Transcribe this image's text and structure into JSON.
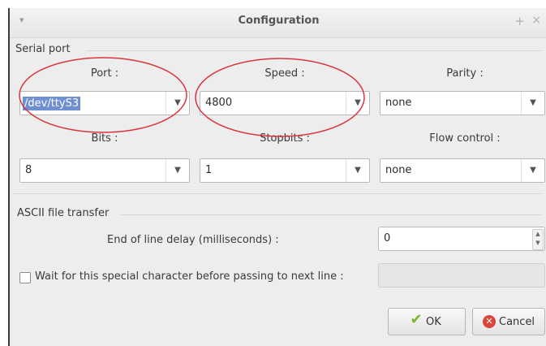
{
  "window": {
    "title": "Configuration",
    "menu_glyph": "▾",
    "max_glyph": "+",
    "close_glyph": "×"
  },
  "serial_port": {
    "section_title": "Serial port",
    "port": {
      "label": "Port :",
      "value": "/dev/ttyS3",
      "selected": true
    },
    "speed": {
      "label": "Speed :",
      "value": "4800"
    },
    "parity": {
      "label": "Parity :",
      "value": "none"
    },
    "bits": {
      "label": "Bits :",
      "value": "8"
    },
    "stopbits": {
      "label": "Stopbits :",
      "value": "1"
    },
    "flow_control": {
      "label": "Flow control :",
      "value": "none"
    },
    "dropdown_arrow": "▼"
  },
  "ascii_transfer": {
    "section_title": "ASCII file transfer",
    "eol_delay_label": "End of line delay (milliseconds) :",
    "eol_delay_value": "0",
    "wait_char_label": "Wait for this special character before passing to next line :",
    "wait_char_checked": false,
    "wait_char_value": ""
  },
  "buttons": {
    "ok_label": "OK",
    "cancel_label": "Cancel",
    "ok_icon": "check-icon",
    "cancel_icon": "cancel-icon"
  },
  "annotation_color": "#d9363e"
}
